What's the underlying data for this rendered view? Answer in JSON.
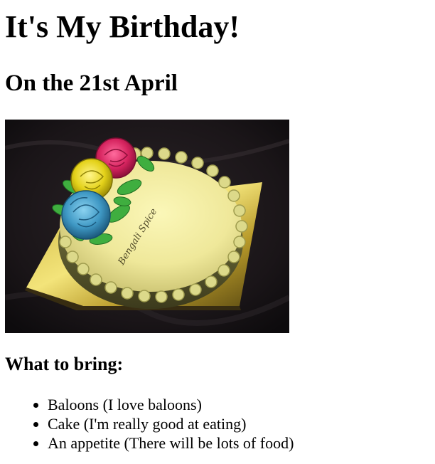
{
  "page": {
    "title": "It's My Birthday!",
    "subtitle": "On the 21st April",
    "image": {
      "watermark": "Bengali Spice"
    },
    "bring_heading": "What to bring:",
    "bring_items": [
      "Baloons (I love baloons)",
      "Cake (I'm really good at eating)",
      "An appetite (There will be lots of food)"
    ]
  }
}
